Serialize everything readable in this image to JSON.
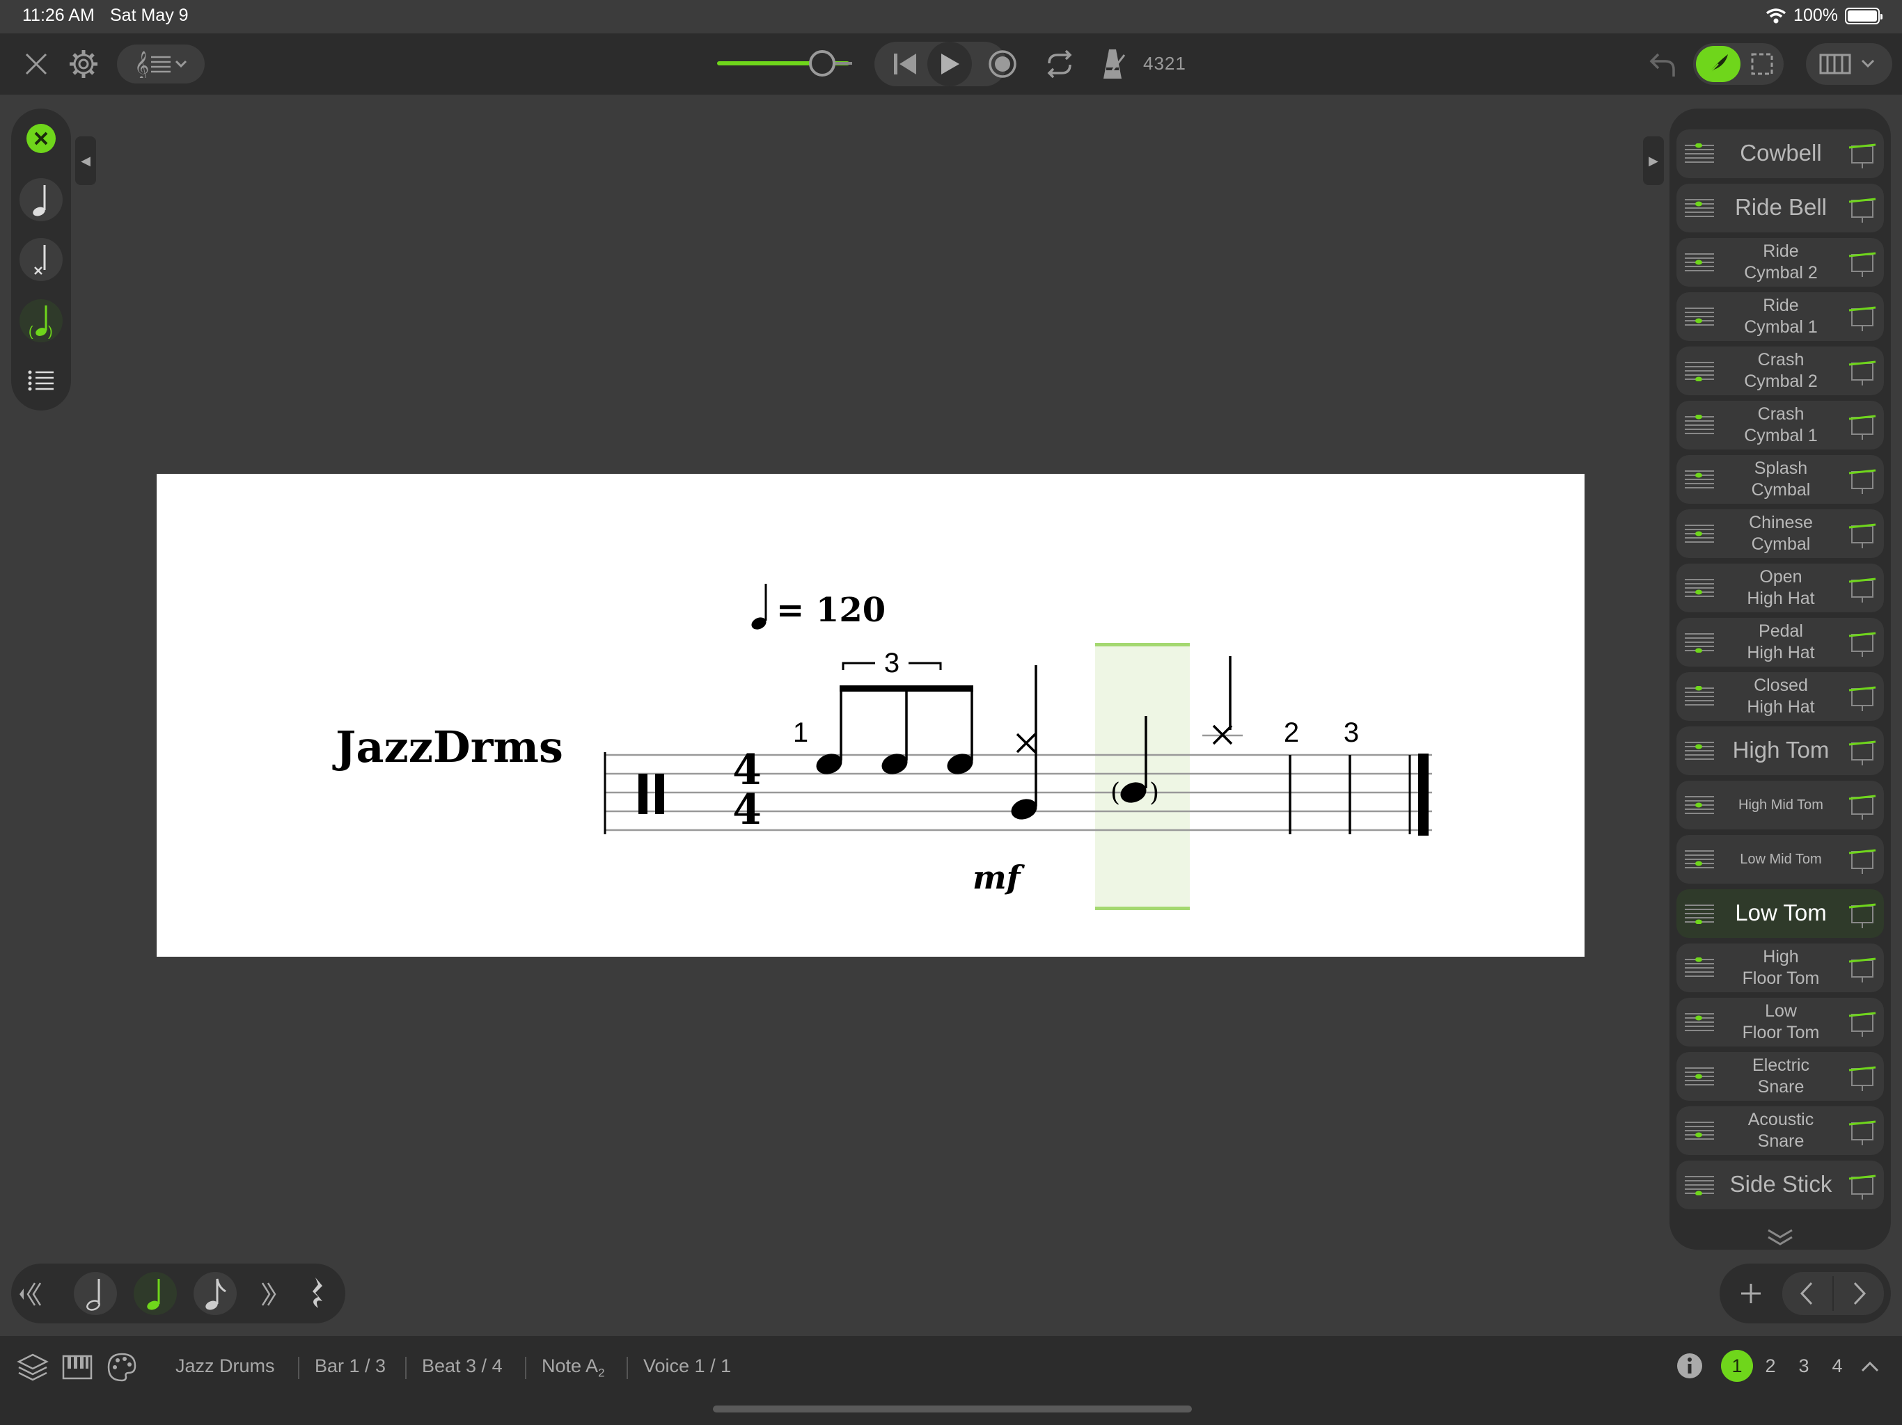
{
  "status": {
    "time": "11:26 AM",
    "date": "Sat May 9",
    "battery": "100%"
  },
  "toolbar": {
    "count_in": "4321",
    "tempo_progress": 0.78
  },
  "score": {
    "part_name": "JazzDrms",
    "tempo_value": "= 120",
    "time_signature_top": "4",
    "time_signature_bottom": "4",
    "dynamic": "mf",
    "tuplet": "3",
    "bar_numbers": [
      "1",
      "2",
      "3"
    ]
  },
  "instruments": [
    {
      "label": "Cowbell",
      "size": "big"
    },
    {
      "label": "Ride Bell",
      "size": "big"
    },
    {
      "label": "Ride Cymbal 2",
      "line1": "Ride",
      "line2": "Cymbal 2"
    },
    {
      "label": "Ride Cymbal 1",
      "line1": "Ride",
      "line2": "Cymbal 1"
    },
    {
      "label": "Crash Cymbal 2",
      "line1": "Crash",
      "line2": "Cymbal 2"
    },
    {
      "label": "Crash Cymbal 1",
      "line1": "Crash",
      "line2": "Cymbal 1"
    },
    {
      "label": "Splash Cymbal",
      "line1": "Splash",
      "line2": "Cymbal"
    },
    {
      "label": "Chinese Cymbal",
      "line1": "Chinese",
      "line2": "Cymbal"
    },
    {
      "label": "Open High Hat",
      "line1": "Open",
      "line2": "High Hat"
    },
    {
      "label": "Pedal High Hat",
      "line1": "Pedal",
      "line2": "High Hat"
    },
    {
      "label": "Closed High Hat",
      "line1": "Closed",
      "line2": "High Hat"
    },
    {
      "label": "High Tom",
      "size": "big"
    },
    {
      "label": "High Mid Tom",
      "size": "small"
    },
    {
      "label": "Low Mid Tom",
      "size": "small"
    },
    {
      "label": "Low Tom",
      "size": "big",
      "active": true
    },
    {
      "label": "High Floor Tom",
      "line1": "High",
      "line2": "Floor Tom"
    },
    {
      "label": "Low Floor Tom",
      "line1": "Low",
      "line2": "Floor Tom"
    },
    {
      "label": "Electric Snare",
      "line1": "Electric",
      "line2": "Snare"
    },
    {
      "label": "Acoustic Snare",
      "line1": "Acoustic",
      "line2": "Snare"
    },
    {
      "label": "Side Stick",
      "size": "big"
    }
  ],
  "bottombar": {
    "instrument": "Jazz Drums",
    "bar": "Bar 1 / 3",
    "beat": "Beat 3 / 4",
    "note": "Note A",
    "note_sub": "2",
    "voice": "Voice 1 / 1",
    "pages": [
      "1",
      "2",
      "3",
      "4"
    ],
    "active_page": "1"
  },
  "colors": {
    "accent": "#6fd61b",
    "selection": "#eef6e4",
    "selection_bar": "#a4d870"
  }
}
